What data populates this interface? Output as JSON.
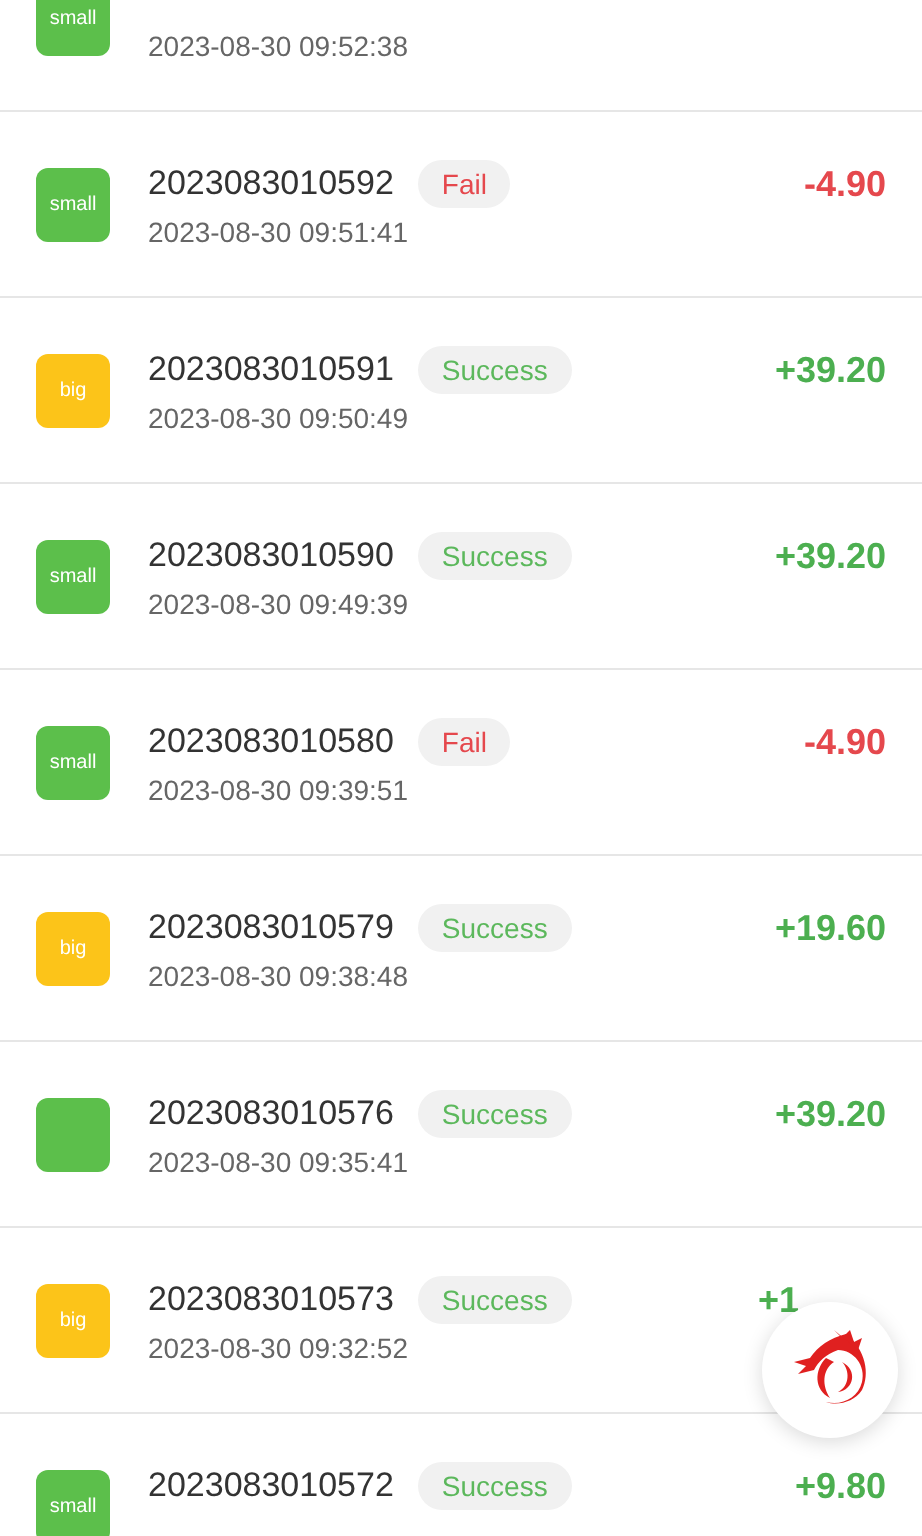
{
  "records": [
    {
      "icon": {
        "kind": "small",
        "label": "small"
      },
      "time": "2023-08-30 09:52:38"
    },
    {
      "icon": {
        "kind": "small",
        "label": "small"
      },
      "number": "2023083010592",
      "status": {
        "kind": "fail",
        "text": "Fail"
      },
      "time": "2023-08-30 09:51:41",
      "amount": {
        "kind": "loss",
        "text": "-4.90"
      }
    },
    {
      "icon": {
        "kind": "big",
        "label": "big"
      },
      "number": "2023083010591",
      "status": {
        "kind": "success",
        "text": "Success"
      },
      "time": "2023-08-30 09:50:49",
      "amount": {
        "kind": "gain",
        "text": "+39.20"
      }
    },
    {
      "icon": {
        "kind": "small",
        "label": "small"
      },
      "number": "2023083010590",
      "status": {
        "kind": "success",
        "text": "Success"
      },
      "time": "2023-08-30 09:49:39",
      "amount": {
        "kind": "gain",
        "text": "+39.20"
      }
    },
    {
      "icon": {
        "kind": "small",
        "label": "small"
      },
      "number": "2023083010580",
      "status": {
        "kind": "fail",
        "text": "Fail"
      },
      "time": "2023-08-30 09:39:51",
      "amount": {
        "kind": "loss",
        "text": "-4.90"
      }
    },
    {
      "icon": {
        "kind": "big",
        "label": "big"
      },
      "number": "2023083010579",
      "status": {
        "kind": "success",
        "text": "Success"
      },
      "time": "2023-08-30 09:38:48",
      "amount": {
        "kind": "gain",
        "text": "+19.60"
      }
    },
    {
      "icon": {
        "kind": "small"
      },
      "number": "2023083010576",
      "status": {
        "kind": "success",
        "text": "Success"
      },
      "time": "2023-08-30 09:35:41",
      "amount": {
        "kind": "gain",
        "text": "+39.20"
      }
    },
    {
      "icon": {
        "kind": "big",
        "label": "big"
      },
      "number": "2023083010573",
      "status": {
        "kind": "success",
        "text": "Success"
      },
      "time": "2023-08-30 09:32:52",
      "amount": {
        "kind": "gain",
        "text": "+1",
        "covered": true
      }
    },
    {
      "icon": {
        "kind": "small",
        "label": "small"
      },
      "number": "2023083010572",
      "status": {
        "kind": "success",
        "text": "Success"
      },
      "amount": {
        "kind": "gain",
        "text": "+9.80"
      }
    }
  ],
  "floating_button": {
    "kind": "dragon"
  }
}
